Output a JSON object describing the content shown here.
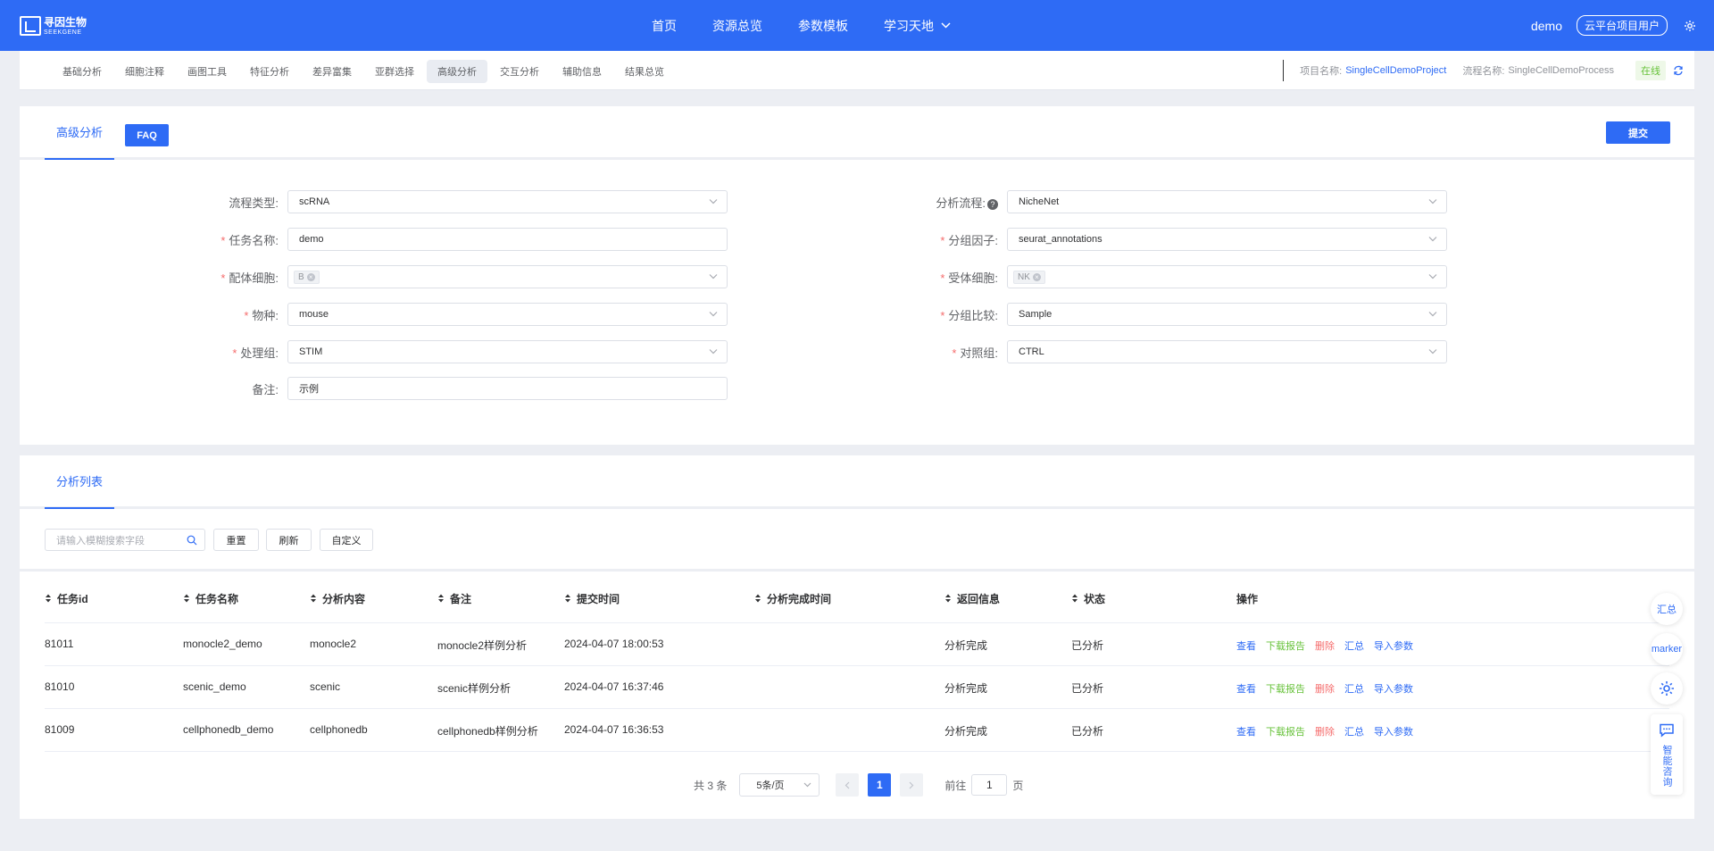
{
  "header": {
    "logo_cn": "寻因生物",
    "logo_en": "SEEKGENE",
    "nav": [
      "首页",
      "资源总览",
      "参数模板",
      "学习天地"
    ],
    "user": "demo",
    "user_badge": "云平台项目用户"
  },
  "subnav": {
    "tabs": [
      "基础分析",
      "细胞注释",
      "画图工具",
      "特征分析",
      "差异富集",
      "亚群选择",
      "高级分析",
      "交互分析",
      "辅助信息",
      "结果总览"
    ],
    "active_tab": "高级分析",
    "project_label": "项目名称:",
    "project_value": "SingleCellDemoProject",
    "process_label": "流程名称:",
    "process_value": "SingleCellDemoProcess",
    "status": "在线"
  },
  "form_card": {
    "tab": "高级分析",
    "faq": "FAQ",
    "submit": "提交",
    "fields": {
      "process_type": {
        "label": "流程类型:",
        "value": "scRNA"
      },
      "task_name": {
        "label": "任务名称:",
        "value": "demo"
      },
      "ligand_cell": {
        "label": "配体细胞:",
        "tag": "B"
      },
      "species": {
        "label": "物种:",
        "value": "mouse"
      },
      "treatment": {
        "label": "处理组:",
        "value": "STIM"
      },
      "remark": {
        "label": "备注:",
        "value": "示例"
      },
      "pipeline": {
        "label": "分析流程:",
        "value": "NicheNet"
      },
      "group_factor": {
        "label": "分组因子:",
        "value": "seurat_annotations"
      },
      "receptor_cell": {
        "label": "受体细胞:",
        "tag": "NK"
      },
      "group_compare": {
        "label": "分组比较:",
        "value": "Sample"
      },
      "control": {
        "label": "对照组:",
        "value": "CTRL"
      }
    }
  },
  "list_card": {
    "tab": "分析列表",
    "search_placeholder": "请输入模糊搜索字段",
    "buttons": {
      "reset": "重置",
      "refresh": "刷新",
      "custom": "自定义"
    },
    "columns": [
      "任务id",
      "任务名称",
      "分析内容",
      "备注",
      "提交时间",
      "分析完成时间",
      "返回信息",
      "状态",
      "操作"
    ],
    "rows": [
      {
        "id": "81011",
        "name": "monocle2_demo",
        "content": "monocle2",
        "remark": "monocle2样例分析",
        "submit_time": "2024-04-07 18:00:53",
        "finish_time": "",
        "message": "分析完成",
        "status": "已分析"
      },
      {
        "id": "81010",
        "name": "scenic_demo",
        "content": "scenic",
        "remark": "scenic样例分析",
        "submit_time": "2024-04-07 16:37:46",
        "finish_time": "",
        "message": "分析完成",
        "status": "已分析"
      },
      {
        "id": "81009",
        "name": "cellphonedb_demo",
        "content": "cellphonedb",
        "remark": "cellphonedb样例分析",
        "submit_time": "2024-04-07 16:36:53",
        "finish_time": "",
        "message": "分析完成",
        "status": "已分析"
      }
    ],
    "ops": [
      "查看",
      "下载报告",
      "删除",
      "汇总",
      "导入参数"
    ],
    "pager": {
      "total": "共 3 条",
      "page_size": "5条/页",
      "current": "1",
      "goto_label": "前往",
      "goto_value": "1",
      "page_unit": "页"
    }
  },
  "side": {
    "summary": "汇总",
    "marker": "marker",
    "ai": "智能咨询"
  },
  "colors": {
    "primary": "#2e6bf5",
    "success": "#67c23a",
    "danger": "#f56c6c"
  }
}
